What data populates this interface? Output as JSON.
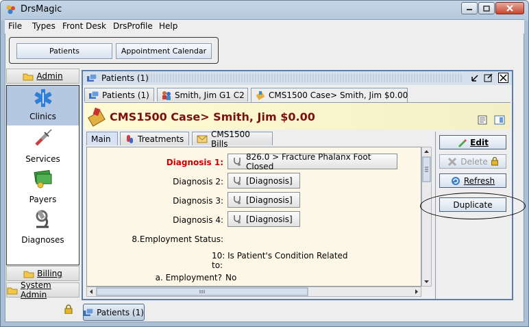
{
  "window": {
    "title": "DrsMagic",
    "app_icon": "drsmagic-logo-icon"
  },
  "menubar": {
    "items": [
      "File",
      "Types",
      "Front Desk",
      "DrsProfile",
      "Help"
    ]
  },
  "toolbar": {
    "patients_label": "Patients",
    "calendar_label": "Appointment Calendar"
  },
  "nav": {
    "admin_label": "Admin",
    "billing_label": "Billing",
    "system_admin_label": "System Admin",
    "items": [
      {
        "label": "Clinics",
        "icon": "clinic-star-of-life-icon",
        "selected": true
      },
      {
        "label": "Services",
        "icon": "syringe-icon"
      },
      {
        "label": "Payers",
        "icon": "money-icon"
      },
      {
        "label": "Diagnoses",
        "icon": "microscope-icon"
      }
    ]
  },
  "frame": {
    "title": "Patients (1)",
    "tabs": [
      "Patients (1)",
      "Smith, Jim G1 C2",
      "CMS1500 Case> Smith, Jim $0.00"
    ],
    "header": "CMS1500 Case> Smith, Jim $0.00",
    "subtabs": [
      "Main",
      "Treatments",
      "CMS1500 Bills"
    ]
  },
  "form": {
    "diagnosis1_label": "Diagnosis 1:",
    "diagnosis1_value": "826.0 > Fracture Phalanx Foot Closed",
    "diagnosis2_label": "Diagnosis 2:",
    "diagnosis2_value": "[Diagnosis]",
    "diagnosis3_label": "Diagnosis 3:",
    "diagnosis3_value": "[Diagnosis]",
    "diagnosis4_label": "Diagnosis 4:",
    "diagnosis4_value": "[Diagnosis]",
    "employment_status_label": "8.Employment Status:",
    "condition_related_label": "10: Is Patient's Condition Related to:",
    "employment_label": "a. Employment?",
    "employment_value": "No"
  },
  "actions": {
    "edit_label": "Edit",
    "delete_label": "Delete",
    "refresh_label": "Refresh",
    "duplicate_label": "Duplicate"
  },
  "taskbar": {
    "label": "Patients (1)"
  },
  "colors": {
    "header_text": "#7a1010",
    "required_label": "#cc0000",
    "nav_selected": "#b4c8e2"
  }
}
